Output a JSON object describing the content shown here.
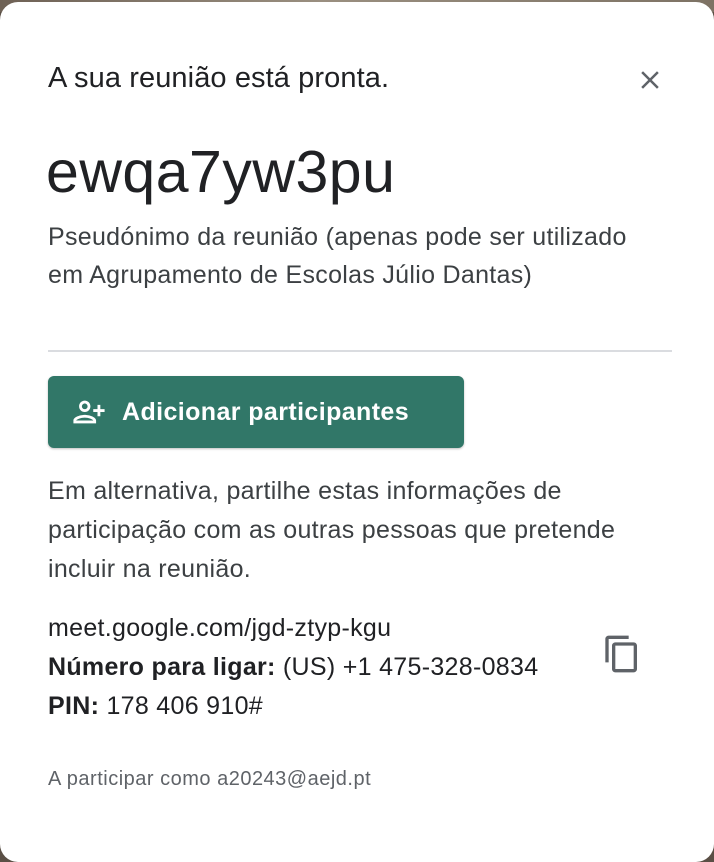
{
  "dialog": {
    "title": "A sua reunião está pronta.",
    "close_icon": "close-icon"
  },
  "meeting": {
    "nickname": "ewqa7yw3pu",
    "nickname_description": "Pseudónimo da reunião (apenas pode ser utilizado em Agrupamento de Escolas Júlio Dantas)"
  },
  "add_participants": {
    "icon": "person-add-icon",
    "label": "Adicionar participantes",
    "color": "#317768"
  },
  "share": {
    "description": "Em alternativa, partilhe estas informações de participação com as outras pessoas que pretende incluir na reunião.",
    "link": "meet.google.com/jgd-ztyp-kgu",
    "phone_label": "Número para ligar:",
    "phone_value": " (US) +1 475-328-0834",
    "pin_label": "PIN:",
    "pin_value": " 178 406 910#",
    "copy_icon": "copy-icon"
  },
  "footer": {
    "joining_as": "A participar como a20243@aejd.pt"
  }
}
